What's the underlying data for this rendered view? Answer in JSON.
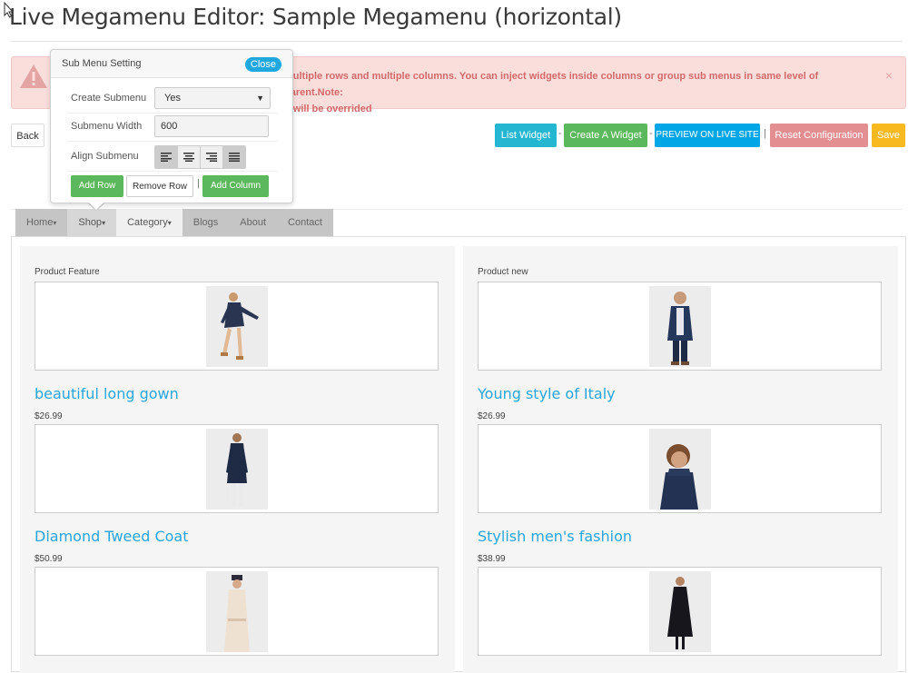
{
  "page": {
    "title": "Live Megamenu Editor: Sample Megamenu (horizontal)"
  },
  "alert": {
    "text": "multiple rows and multiple columns. You can inject widgets inside columns or group sub menus in same level of parent.Note:\ng will be overrided",
    "close": "×",
    "icon": "warning-icon"
  },
  "toolbar": {
    "back": "Back",
    "list_widget": "List Widget",
    "create_widget": "Create A Widget",
    "preview": "PREVIEW ON LIVE SITE",
    "reset": "Reset Configuration",
    "save": "Save",
    "sep_dash": "-",
    "sep_bar": "|"
  },
  "popup": {
    "title": "Sub Menu Setting",
    "close": "Close",
    "create_label": "Create Submenu",
    "create_value": "Yes",
    "width_label": "Submenu Width",
    "width_value": "600",
    "align_label": "Align Submenu",
    "add_row": "Add Row",
    "remove_row": "Remove Row",
    "sep": "|",
    "add_column": "Add Column"
  },
  "menu": {
    "items": [
      {
        "label": "Home",
        "caret": "▾"
      },
      {
        "label": "Shop",
        "caret": "▾"
      },
      {
        "label": "Category",
        "caret": "▾"
      },
      {
        "label": "Blogs",
        "caret": ""
      },
      {
        "label": "About",
        "caret": ""
      },
      {
        "label": "Contact",
        "caret": ""
      }
    ]
  },
  "columns": [
    {
      "title": "Product Feature",
      "products": [
        {
          "name": "beautiful long gown",
          "price": "$26.99"
        },
        {
          "name": "Diamond Tweed Coat",
          "price": "$50.99"
        },
        {
          "name": "",
          "price": ""
        }
      ]
    },
    {
      "title": "Product new",
      "products": [
        {
          "name": "Young style of Italy",
          "price": "$26.99"
        },
        {
          "name": "Stylish men's fashion",
          "price": "$38.99"
        },
        {
          "name": "",
          "price": ""
        }
      ]
    }
  ],
  "colors": {
    "accent": "#28a6dc",
    "alert_bg": "#f9dedc",
    "alert_text": "#d2696a",
    "success": "#5cb85c",
    "info": "#25b6d2",
    "preview": "#00a6e6",
    "danger": "#e38e91",
    "warning": "#f8b81f"
  }
}
